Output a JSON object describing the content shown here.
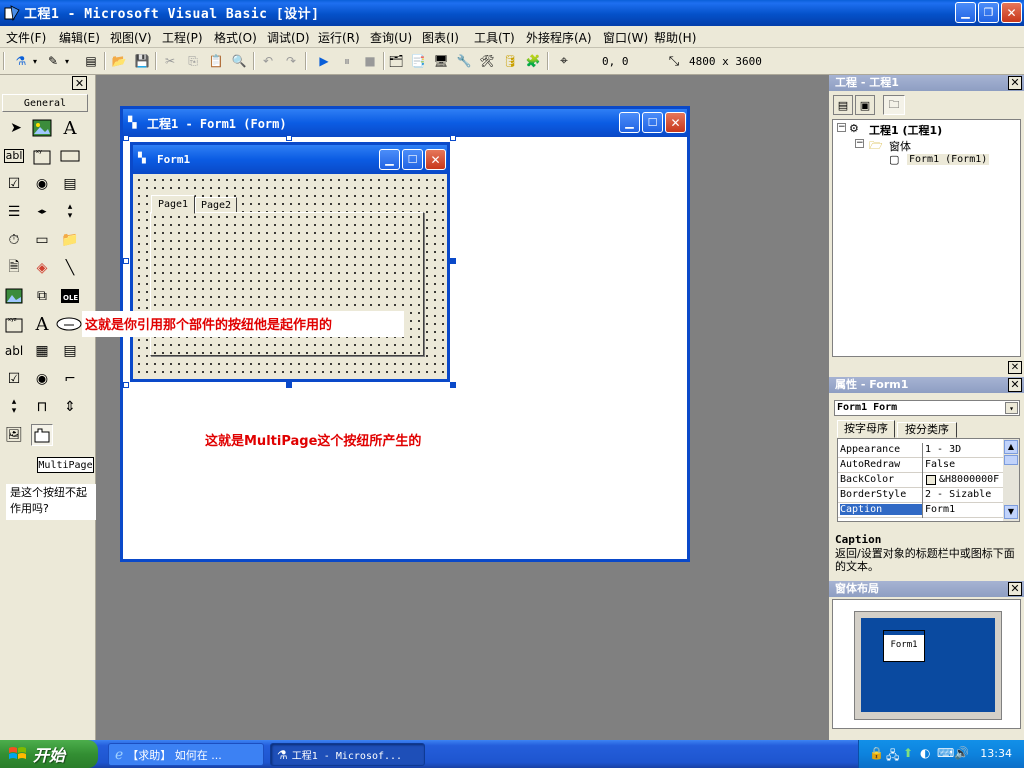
{
  "window": {
    "title": "工程1 - Microsoft Visual Basic [设计]"
  },
  "menu": [
    "文件(F)",
    "编辑(E)",
    "视图(V)",
    "工程(P)",
    "格式(O)",
    "调试(D)",
    "运行(R)",
    "查询(U)",
    "图表(I)",
    "工具(T)",
    "外接程序(A)",
    "窗口(W)",
    "帮助(H)"
  ],
  "toolbar": {
    "position": "0, 0",
    "size": "4800 x 3600"
  },
  "toolbox": {
    "tab": "General",
    "tooltip": "MultiPage"
  },
  "designer": {
    "title": "工程1 - Form1 (Form)"
  },
  "form": {
    "title": "Form1"
  },
  "multipage": {
    "tabs": [
      "Page1",
      "Page2"
    ]
  },
  "annotations": {
    "reference": "这就是你引用那个部件的按纽他是起作用的",
    "multipage": "这就是MultiPage这个按纽所产生的",
    "question": "是这个按纽不起作用吗?"
  },
  "project_panel": {
    "title": "工程 - 工程1",
    "tree": {
      "project": "工程1 (工程1)",
      "folder": "窗体",
      "form": "Form1 (Form1)"
    }
  },
  "properties_panel": {
    "title": "属性 - Form1",
    "object": "Form1 Form",
    "tabs": [
      "按字母序",
      "按分类序"
    ],
    "rows": [
      {
        "name": "Appearance",
        "value": "1 - 3D"
      },
      {
        "name": "AutoRedraw",
        "value": "False"
      },
      {
        "name": "BackColor",
        "value": "&H8000000F"
      },
      {
        "name": "BorderStyle",
        "value": "2 - Sizable"
      },
      {
        "name": "Caption",
        "value": "Form1"
      }
    ],
    "desc_title": "Caption",
    "desc_text": "返回/设置对象的标题栏中或图标下面的文本。"
  },
  "layout_panel": {
    "title": "窗体布局",
    "form_label": "Form1"
  },
  "taskbar": {
    "start": "开始",
    "tasks": [
      "【求助】 如何在 ...",
      "工程1 - Microsof..."
    ],
    "clock": "13:34"
  },
  "colors": {
    "title_blue": "#0a5fd8",
    "annotation_red": "#e00000",
    "taskbar_blue": "#245edb",
    "start_green": "#338f33"
  }
}
